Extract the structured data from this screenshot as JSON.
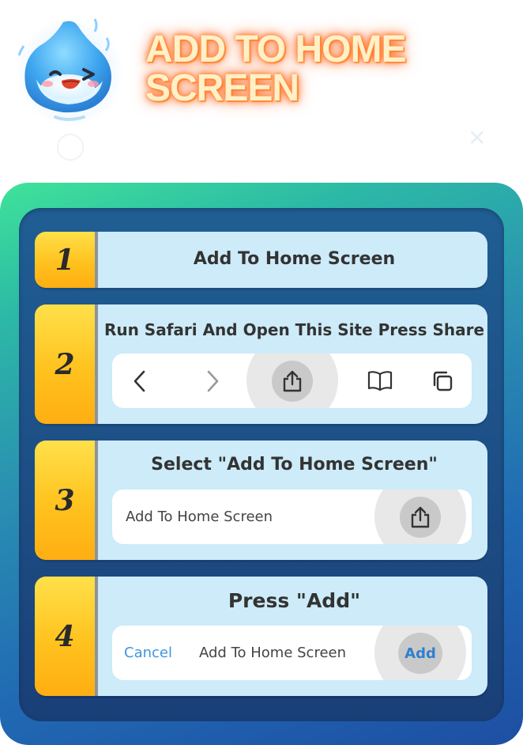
{
  "header": {
    "title_line1": "ADD TO HOME",
    "title_line2": "SCREEN"
  },
  "steps": [
    {
      "number": "1",
      "title": "Add To Home Screen"
    },
    {
      "number": "2",
      "title": "Run Safari And Open This Site Press Share",
      "toolbar_icons": [
        "back-icon",
        "forward-icon",
        "share-icon",
        "bookmarks-icon",
        "tabs-icon"
      ]
    },
    {
      "number": "3",
      "title": "Select \"Add To Home Screen\"",
      "option_label": "Add To Home Screen",
      "option_icon": "share-icon"
    },
    {
      "number": "4",
      "title": "Press \"Add\"",
      "cancel_label": "Cancel",
      "dialog_title": "Add To Home Screen",
      "add_label": "Add"
    }
  ],
  "colors": {
    "accent_blue": "#3d96e0",
    "step_number_yellow": "#ffc21e",
    "step_background": "#cdebf8",
    "title_glow": "#ff7a2a"
  }
}
